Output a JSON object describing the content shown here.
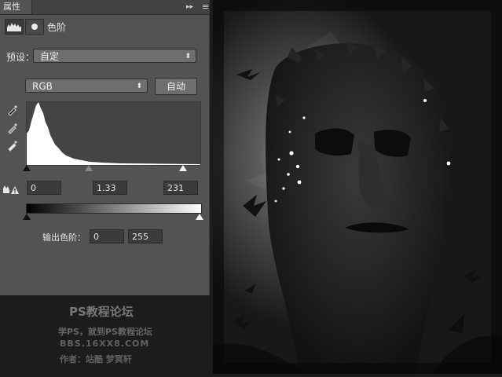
{
  "panel": {
    "tab_label": "属性",
    "collapse_glyph": "▸▸",
    "menu_glyph": "≡",
    "title": "色阶"
  },
  "preset": {
    "label": "预设：",
    "value": "自定"
  },
  "channel": {
    "value": "RGB",
    "auto_label": "自动"
  },
  "input_levels": {
    "black": "0",
    "gamma": "1.33",
    "white": "231"
  },
  "output_levels": {
    "label": "输出色阶：",
    "black": "0",
    "white": "255"
  },
  "watermark": {
    "line1": "PS教程论坛",
    "line2": "学PS，就到PS教程论坛",
    "line3": "BBS.16XX8.COM",
    "line4": "作者：站酷 梦冥轩"
  },
  "icons": [
    "levels-icon",
    "mask-icon",
    "eyedropper-black-icon",
    "eyedropper-gray-icon",
    "eyedropper-white-icon",
    "clipping-warning-icon"
  ],
  "colors": {
    "panel": "#535353",
    "tabbar": "#424242",
    "input": "#3b3b3b",
    "histogram_bg": "#444444"
  }
}
